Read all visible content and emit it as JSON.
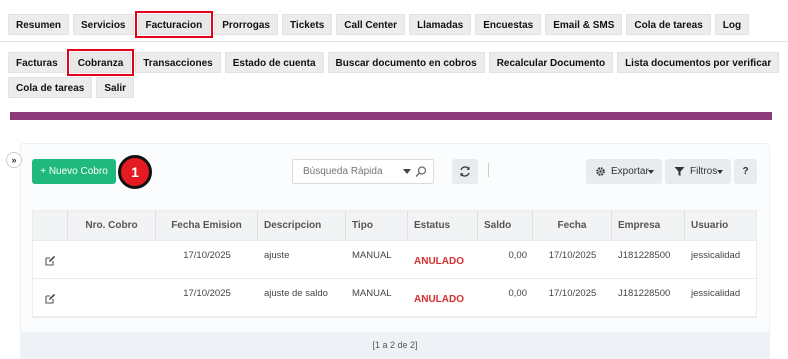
{
  "main_tabs": [
    "Resumen",
    "Servicios",
    "Facturacion",
    "Prorrogas",
    "Tickets",
    "Call Center",
    "Llamadas",
    "Encuestas",
    "Email & SMS",
    "Cola de tareas",
    "Log"
  ],
  "sub_tabs_row1": [
    "Facturas",
    "Cobranza",
    "Transacciones",
    "Estado de cuenta",
    "Buscar documento en cobros",
    "Recalcular Documento",
    "Lista documentos por verificar"
  ],
  "sub_tabs_row2": [
    "Cola de tareas",
    "Salir"
  ],
  "toolbar": {
    "toggle_label": "»",
    "new_button": "+ Nuevo Cobro",
    "badge": "1",
    "search_placeholder": "Búsqueda Rápida",
    "export_label": "Exportar",
    "filter_label": "Filtros",
    "help_label": "?"
  },
  "table": {
    "headers": [
      "",
      "Nro. Cobro",
      "Fecha Emision",
      "Descripcion",
      "Tipo",
      "Estatus",
      "Saldo",
      "Fecha",
      "Empresa",
      "Usuario"
    ],
    "rows": [
      {
        "nro": "",
        "fecha_emision": "17/10/2025",
        "descripcion": "ajuste",
        "tipo": "MANUAL",
        "estatus": "ANULADO",
        "saldo": "0,00",
        "fecha": "17/10/2025",
        "empresa": "J181228500",
        "usuario": "jessicalidad"
      },
      {
        "nro": "",
        "fecha_emision": "17/10/2025",
        "descripcion": "ajuste de saldo",
        "tipo": "MANUAL",
        "estatus": "ANULADO",
        "saldo": "0,00",
        "fecha": "17/10/2025",
        "empresa": "J181228500",
        "usuario": "jessicalidad"
      }
    ]
  },
  "pagination": "[1 a 2 de 2]",
  "colors": {
    "accent_green": "#20b97d",
    "highlight_red": "#e3001b",
    "purple_bar": "#8b3b78",
    "status_red": "#d32f2f"
  }
}
